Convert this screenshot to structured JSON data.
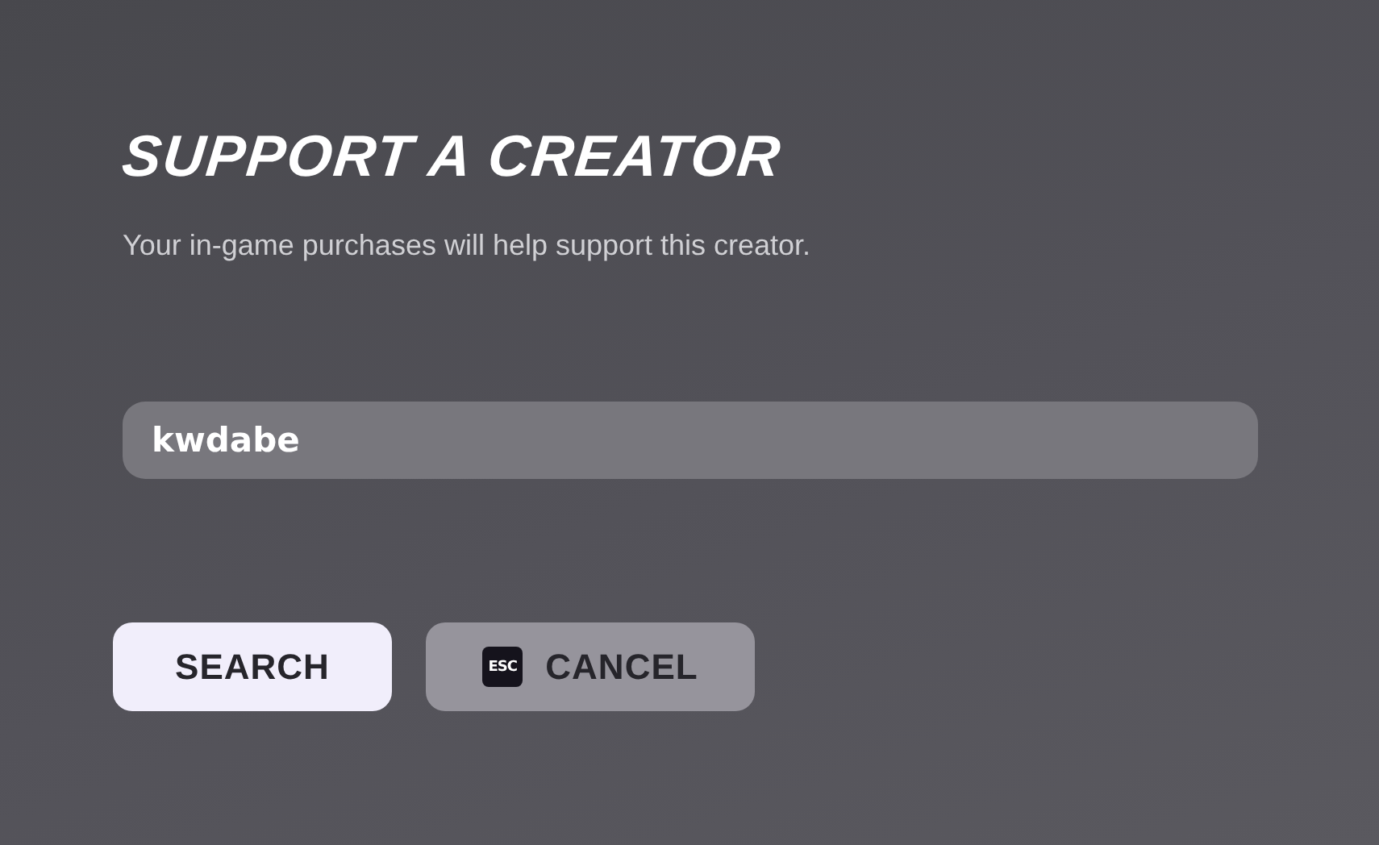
{
  "title": "SUPPORT A CREATOR",
  "subtitle": "Your in-game purchases will help support this creator.",
  "creator_field": {
    "value": "kwdabe"
  },
  "buttons": [
    {
      "label": "SEARCH",
      "kind": "primary"
    },
    {
      "label": "CANCEL",
      "kind": "secondary",
      "key": "ESC"
    }
  ]
}
